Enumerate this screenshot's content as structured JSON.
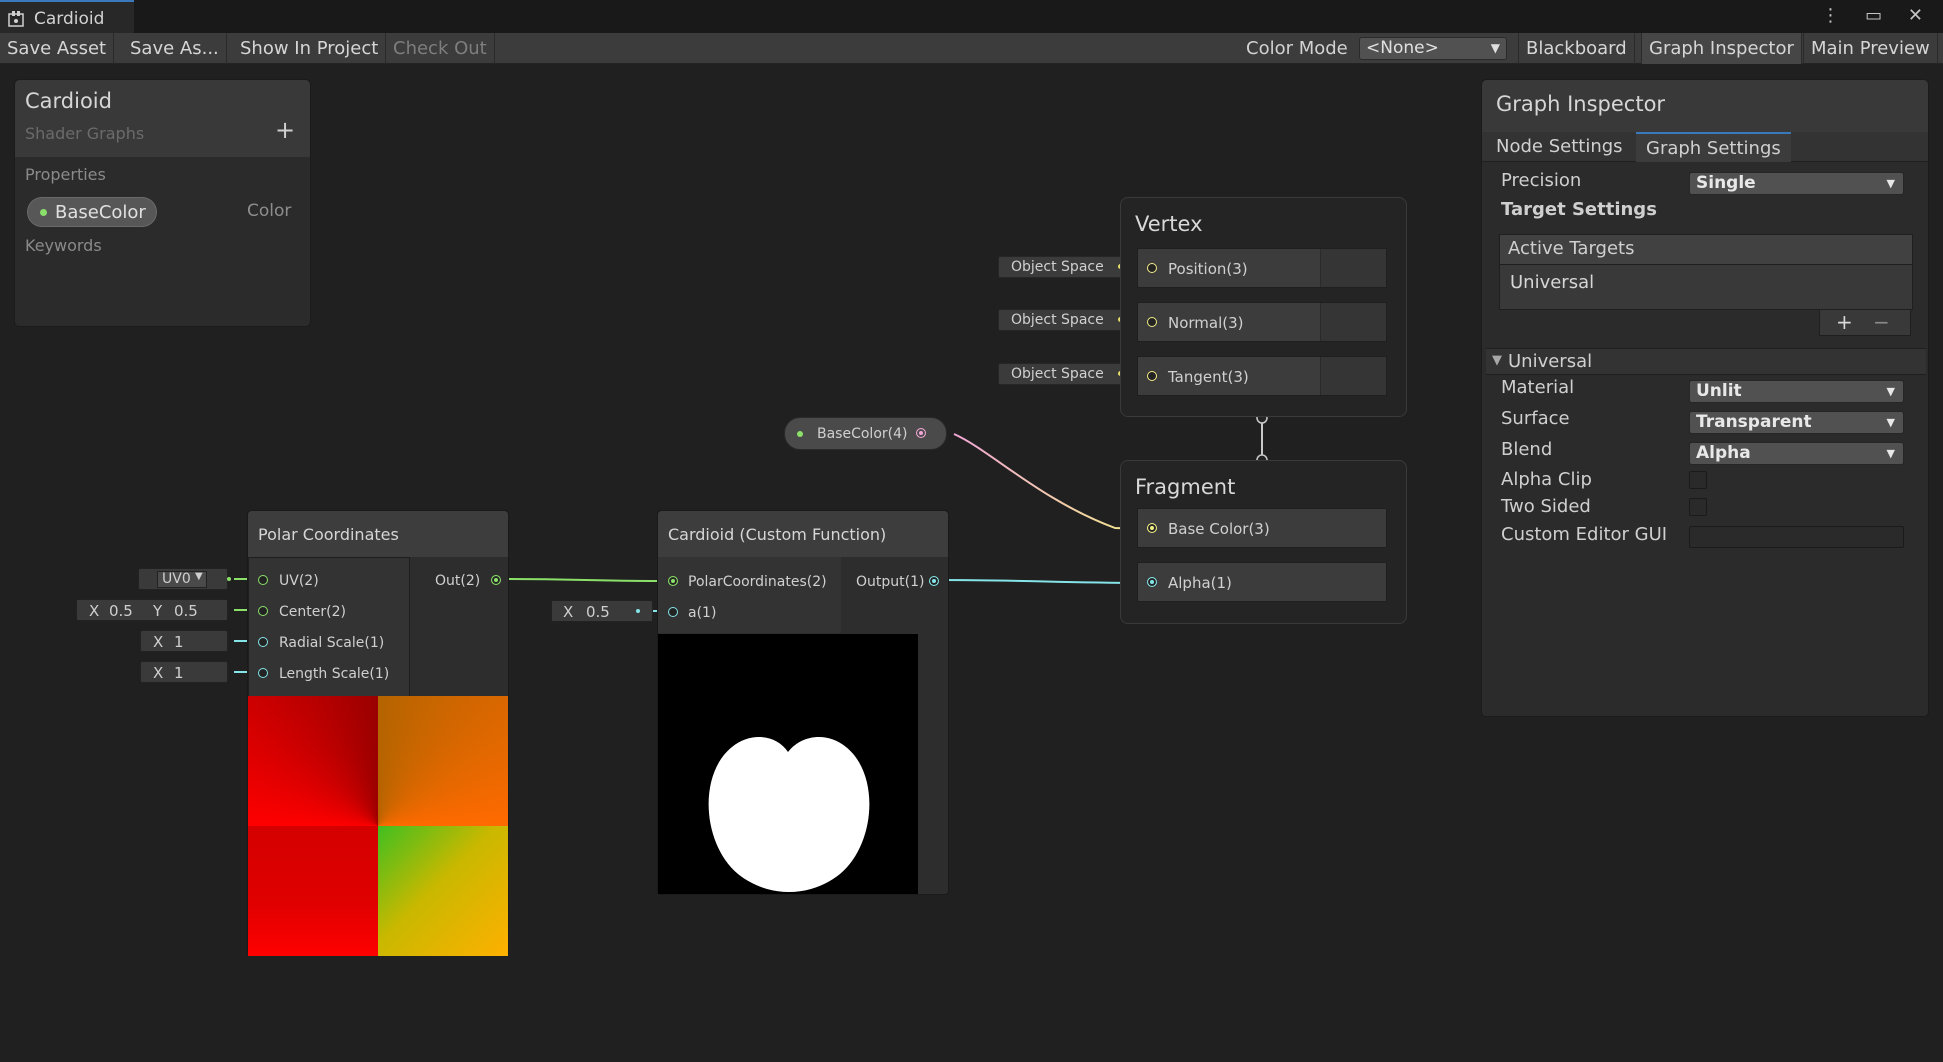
{
  "window": {
    "tab_title": "Cardioid",
    "controls": "⋮ ▭ ✕"
  },
  "toolbar": {
    "save_asset": "Save Asset",
    "save_as": "Save As...",
    "show_in_project": "Show In Project",
    "check_out": "Check Out",
    "color_mode_label": "Color Mode",
    "color_mode_value": "<None>",
    "blackboard": "Blackboard",
    "graph_inspector": "Graph Inspector",
    "main_preview": "Main Preview"
  },
  "blackboard": {
    "title": "Cardioid",
    "subtitle": "Shader Graphs",
    "add_icon": "+",
    "properties_label": "Properties",
    "property_name": "BaseColor",
    "property_type": "Color",
    "keywords_label": "Keywords"
  },
  "polar_node": {
    "title": "Polar Coordinates",
    "inputs": [
      "UV(2)",
      "Center(2)",
      "Radial Scale(1)",
      "Length Scale(1)"
    ],
    "output": "Out(2)",
    "uv_value": "UV0",
    "center_x_label": "X",
    "center_x": "0.5",
    "center_y_label": "Y",
    "center_y": "0.5",
    "radial_x_label": "X",
    "radial_x": "1",
    "length_x_label": "X",
    "length_x": "1"
  },
  "cardioid_node": {
    "title": "Cardioid (Custom Function)",
    "inputs": [
      "PolarCoordinates(2)",
      "a(1)"
    ],
    "output": "Output(1)",
    "a_label": "X",
    "a_value": "0.5"
  },
  "property_node": {
    "label": "BaseColor(4)"
  },
  "vertex": {
    "title": "Vertex",
    "blocks": [
      "Position(3)",
      "Normal(3)",
      "Tangent(3)"
    ],
    "spaces": [
      "Object Space",
      "Object Space",
      "Object Space"
    ]
  },
  "fragment": {
    "title": "Fragment",
    "blocks": [
      "Base Color(3)",
      "Alpha(1)"
    ]
  },
  "inspector": {
    "title": "Graph Inspector",
    "tabs": [
      "Node Settings",
      "Graph Settings"
    ],
    "active_tab": "Graph Settings",
    "precision_label": "Precision",
    "precision_value": "Single",
    "target_settings": "Target Settings",
    "active_targets": "Active Targets",
    "target_item": "Universal",
    "add_icon": "+",
    "remove_icon": "−",
    "section": "Universal",
    "material_label": "Material",
    "material_value": "Unlit",
    "surface_label": "Surface",
    "surface_value": "Transparent",
    "blend_label": "Blend",
    "blend_value": "Alpha",
    "alpha_clip_label": "Alpha Clip",
    "alpha_clip": false,
    "two_sided_label": "Two Sided",
    "two_sided": false,
    "custom_gui_label": "Custom Editor GUI",
    "custom_gui_value": ""
  },
  "colors": {
    "port_green": "#8be06a",
    "port_cyan": "#84e4e7",
    "port_yellow": "#f2ec87",
    "port_pink": "#f1a6d6",
    "accent": "#3a79bb"
  }
}
